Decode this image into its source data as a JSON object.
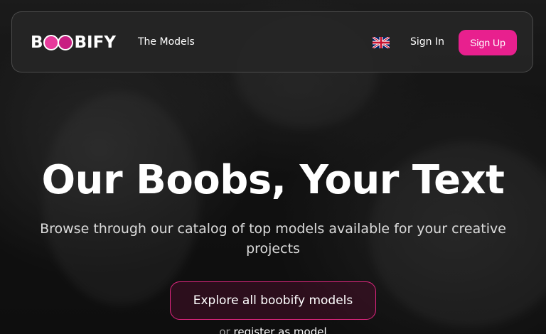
{
  "logo": {
    "text_left": "B",
    "text_right": "BIFY"
  },
  "nav": {
    "models_link": "The Models",
    "language_icon": "uk-flag-icon",
    "sign_in": "Sign In",
    "sign_up": "Sign Up"
  },
  "hero": {
    "title": "Our Boobs, Your Text",
    "subtitle": "Browse through our catalog of top models available for your creative projects",
    "cta_label": "Explore all boobify models",
    "register_prefix": "or",
    "register_link": "register as model"
  },
  "colors": {
    "accent": "#e8208e",
    "cta_border": "#e0267f",
    "navbar_bg": "#262626",
    "background": "#1b1b1b"
  }
}
